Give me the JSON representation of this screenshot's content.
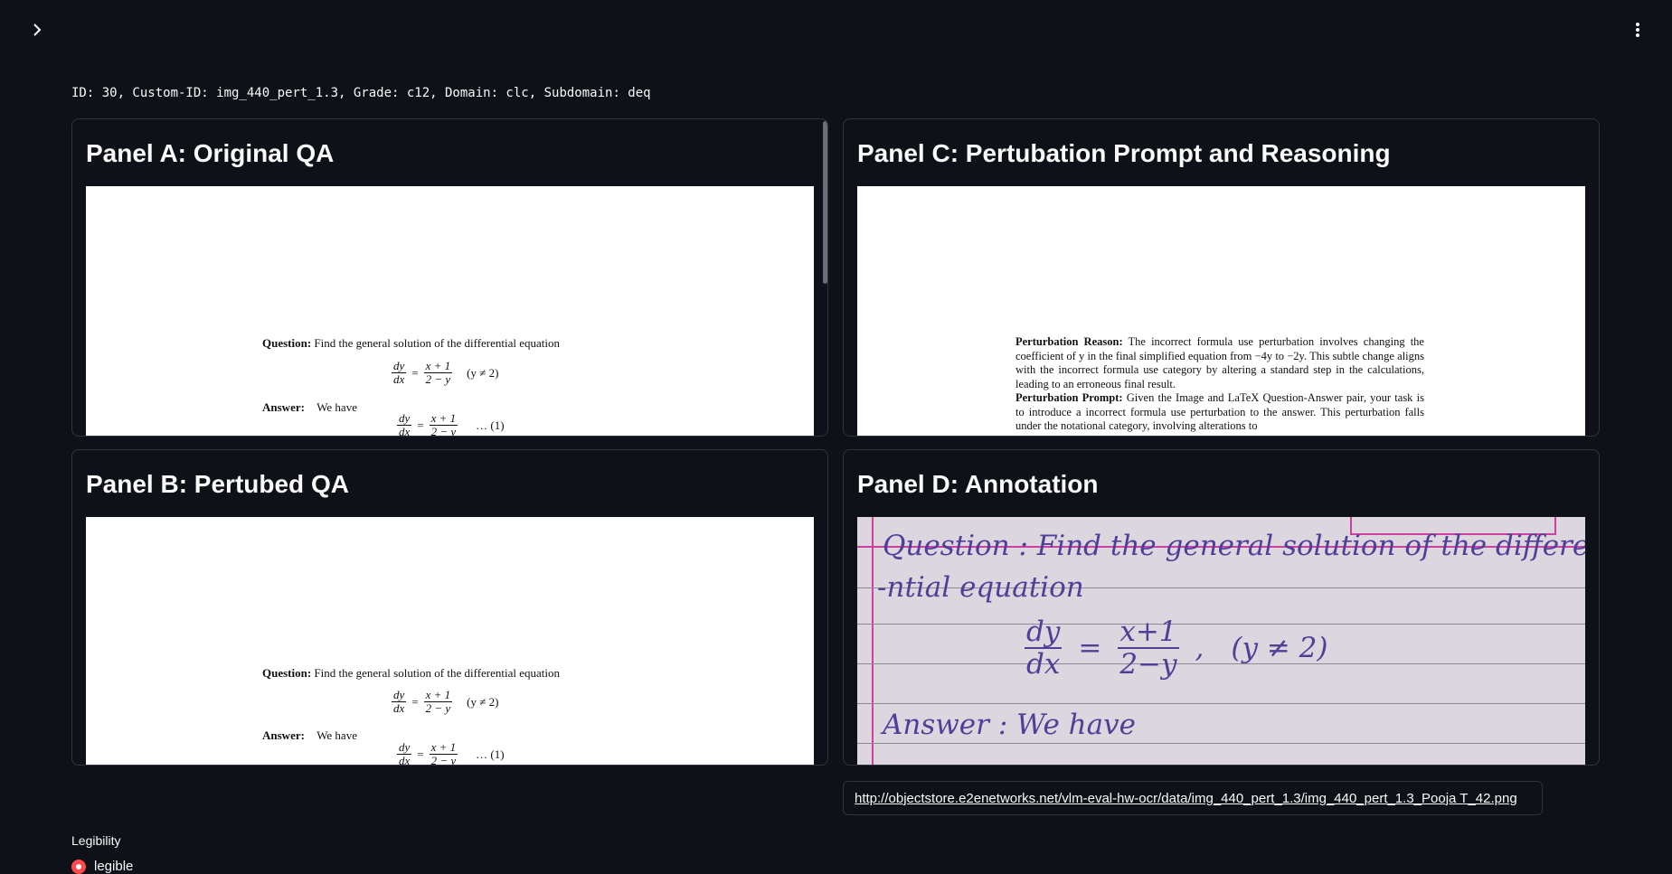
{
  "header": {
    "meta": "ID: 30, Custom-ID: img_440_pert_1.3, Grade: c12, Domain: clc, Subdomain: deq"
  },
  "panels": {
    "a": {
      "title": "Panel A: Original QA",
      "question_label": "Question:",
      "question_text": "Find the general solution of the differential equation",
      "eq_num": "dy",
      "eq_den": "dx",
      "eq_rhs_num": "x + 1",
      "eq_rhs_den": "2 − y",
      "eq_cond": "(y ≠ 2)",
      "answer_label": "Answer:",
      "answer_text": "We have",
      "eq_ref": "… (1)"
    },
    "b": {
      "title": "Panel B: Pertubed QA",
      "question_label": "Question:",
      "question_text": "Find the general solution of the differential equation",
      "eq_num": "dy",
      "eq_den": "dx",
      "eq_rhs_num": "x + 1",
      "eq_rhs_den": "2 − y",
      "eq_cond": "(y ≠ 2)",
      "answer_label": "Answer:",
      "answer_text": "We have",
      "eq_ref": "… (1)"
    },
    "c": {
      "title": "Panel C: Pertubation Prompt and Reasoning",
      "reason_label": "Perturbation Reason:",
      "reason_text": "The incorrect formula use perturbation involves changing the coefficient of y in the final simplified equation from −4y to −2y. This subtle change aligns with the incorrect formula use category by altering a standard step in the calculations, leading to an erroneous final result.",
      "prompt_label": "Perturbation Prompt:",
      "prompt_text": "Given the Image and LaTeX Question-Answer pair, your task is to introduce a incorrect formula use perturbation to the answer. This perturbation falls under the notational category, involving alterations to"
    },
    "d": {
      "title": "Panel D: Annotation",
      "line1": "Question : Find the general solution of the differe-",
      "line2": "-ntial equation",
      "eq": "dy/dx = x+1 / 2−y ,  (y ≠ 2)",
      "eq_left_num": "dy",
      "eq_left_den": "dx",
      "eq_right_num": "x+1",
      "eq_right_den": "2−y",
      "eq_cond": "(y ≠ 2)",
      "line4": "Answer : We have"
    }
  },
  "link": {
    "url": "http://objectstore.e2enetworks.net/vlm-eval-hw-ocr/data/img_440_pert_1.3/img_440_pert_1.3_Pooja T_42.png"
  },
  "legibility": {
    "label": "Legibility",
    "selected": "legible"
  },
  "icons": {
    "expand": "chevron-right-icon",
    "menu": "kebab-menu-icon"
  },
  "colors": {
    "background": "#0e1117",
    "accent": "#ff4b4b"
  }
}
